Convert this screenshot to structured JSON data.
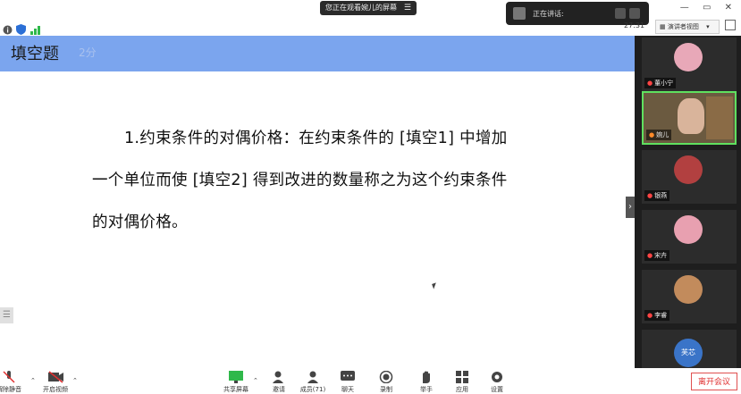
{
  "top": {
    "share_notice": "您正在观看婉儿的屏幕",
    "share_menu_icon": "menu-icon",
    "speaking_label": "正在讲话:",
    "timer": "27:31",
    "view_button": "演讲者视图",
    "view_caret": "▾",
    "window_minimize": "—",
    "window_restore": "▭",
    "window_close": "✕"
  },
  "slide": {
    "title": "填空题",
    "score": "2分",
    "question_lines": [
      "1.约束条件的对偶价格：在约束条件的 [填空1] 中增加",
      "一个单位而使 [填空2] 得到改进的数量称之为这个约束条件",
      "的对偶价格。"
    ]
  },
  "participants": [
    {
      "name": "董小宁",
      "avatar_color": "#e8a8b8"
    },
    {
      "name": "婉儿",
      "avatar_color": "#d9b49b",
      "active": true
    },
    {
      "name": "银燕",
      "avatar_color": "#b24040"
    },
    {
      "name": "宋卉",
      "avatar_color": "#e8a0b0"
    },
    {
      "name": "李睿",
      "avatar_color": "#c28b5c"
    },
    {
      "name": "芙芯",
      "avatar_color": "#3a74c8"
    }
  ],
  "toolbar": {
    "mute": "解除静音",
    "video": "开启视频",
    "share": "共享屏幕",
    "invite": "邀请",
    "members": "成员(71)",
    "chat": "聊天",
    "record": "录制",
    "hand": "举手",
    "apps": "应用",
    "settings": "设置",
    "leave": "离开会议"
  },
  "colors": {
    "title_bar": "#7ba5ee",
    "active_border": "#5fe05f",
    "leave_red": "#e03030"
  }
}
